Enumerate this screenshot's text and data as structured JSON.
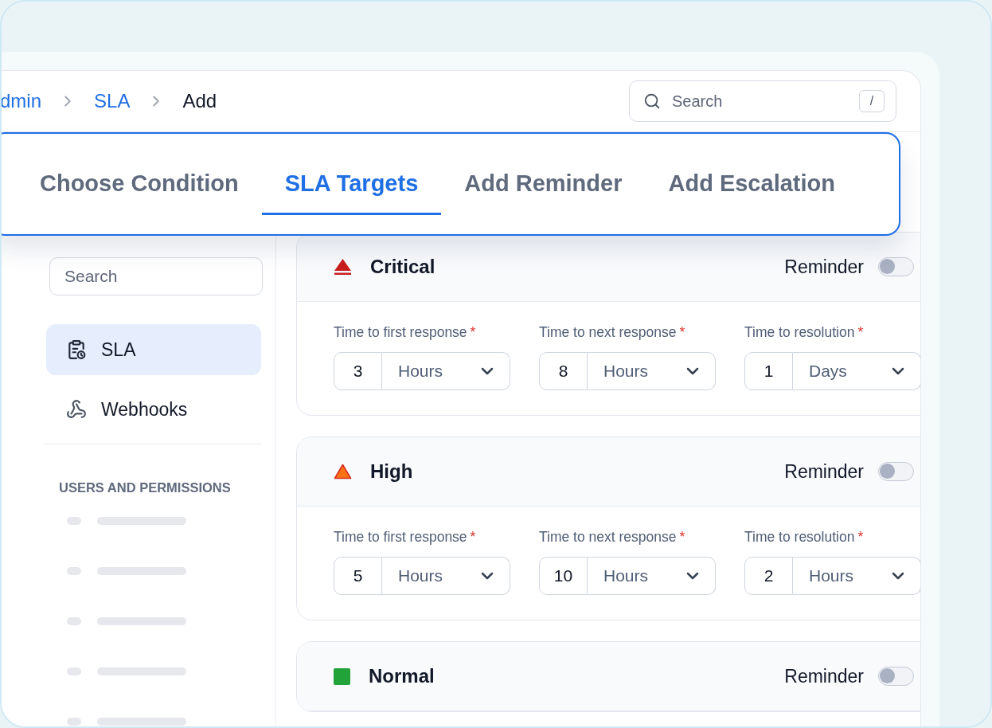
{
  "breadcrumb": [
    {
      "label": "dmin",
      "current": false
    },
    {
      "label": "SLA",
      "current": false
    },
    {
      "label": "Add",
      "current": true
    }
  ],
  "search": {
    "placeholder": "Search",
    "shortcut": "/"
  },
  "tabs": [
    {
      "label": "Choose Condition",
      "selected": false
    },
    {
      "label": "SLA Targets",
      "selected": true
    },
    {
      "label": "Add Reminder",
      "selected": false
    },
    {
      "label": "Add Escalation",
      "selected": false
    }
  ],
  "sidebar": {
    "search": {
      "placeholder": "Search"
    },
    "items": [
      {
        "label": "SLA",
        "selected": true
      },
      {
        "label": "Webhooks",
        "selected": false
      }
    ],
    "section": {
      "title": "USERS AND PERMISSIONS",
      "items": [
        {
          "kind": "skeleton"
        },
        {
          "kind": "skeleton"
        },
        {
          "kind": "skeleton"
        },
        {
          "kind": "skeleton"
        },
        {
          "kind": "skeleton"
        }
      ]
    }
  },
  "priorities": [
    {
      "name": "Critical",
      "kind": "critical",
      "color": "#c81e1e",
      "reminder": {
        "label": "Reminder",
        "on": false
      },
      "targets": [
        {
          "label": "Time to first response",
          "marker": "*",
          "value": "3",
          "unit": "Hours"
        },
        {
          "label": "Time to next response",
          "marker": "*",
          "value": "8",
          "unit": "Hours"
        },
        {
          "label": "Time to resolution",
          "marker": "*",
          "value": "1",
          "unit": "Days"
        }
      ]
    },
    {
      "name": "High",
      "kind": "high",
      "color": "#f97316",
      "reminder": {
        "label": "Reminder",
        "on": false
      },
      "targets": [
        {
          "label": "Time to first response",
          "marker": "*",
          "value": "5",
          "unit": "Hours"
        },
        {
          "label": "Time to next response",
          "marker": "*",
          "value": "10",
          "unit": "Hours"
        },
        {
          "label": "Time to resolution",
          "marker": "*",
          "value": "2",
          "unit": "Hours"
        }
      ]
    },
    {
      "name": "Normal",
      "kind": "normal",
      "color": "#22a33a",
      "reminder": {
        "label": "Reminder",
        "on": false
      }
    }
  ]
}
